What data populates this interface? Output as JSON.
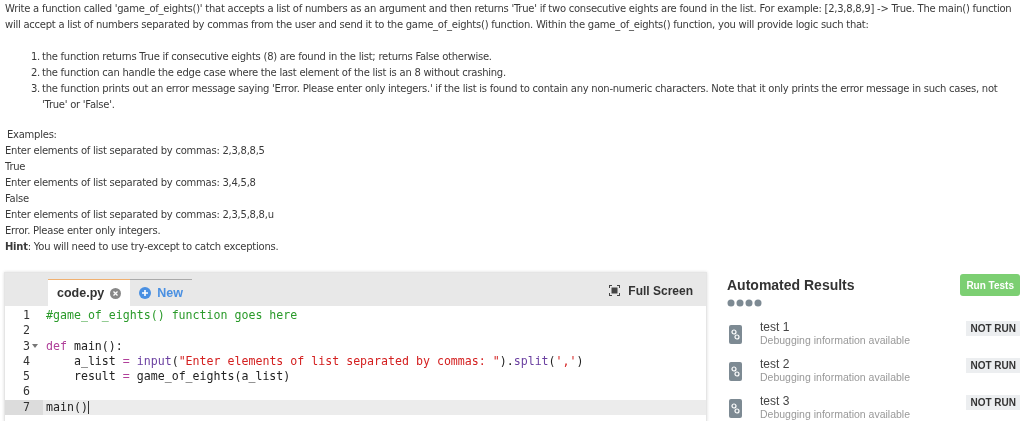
{
  "description": {
    "intro": "Write a function called 'game_of_eights()' that accepts a list of numbers as an argument and then returns 'True' if two consecutive eights are found in the list. For example: [2,3,8,8,9] -> True. The main() function will accept a list of numbers separated by commas from the user and send it to the game_of_eights() function. Within the game_of_eights() function, you will provide logic such that:",
    "requirements": [
      {
        "number": "1.",
        "text": "the function returns True if consecutive eights (8) are found in the list; returns False otherwise."
      },
      {
        "number": "2.",
        "text": "the function can handle the edge case where the last element of the list is an 8 without crashing."
      },
      {
        "number": "3.",
        "text": "the function prints out an error message saying 'Error. Please enter only integers.' if the list is found to contain any non-numeric characters. Note that it only prints the error message in such cases, not 'True' or 'False'."
      }
    ],
    "examples_heading": "Examples:",
    "example_lines": [
      "Enter elements of list separated by commas: 2,3,8,8,5",
      "True",
      "Enter elements of list separated by commas: 3,4,5,8",
      "False",
      "Enter elements of list separated by commas: 2,3,5,8,8,u",
      "Error. Please enter only integers."
    ],
    "hint": "**Hint**: You will need to use try-except to catch exceptions."
  },
  "editor": {
    "tabs": [
      {
        "label": "code.py",
        "kind": "file",
        "selected": true
      },
      {
        "label": "New",
        "kind": "new",
        "selected": false
      }
    ],
    "full_screen": "Full Screen",
    "lines": [
      {
        "number": "1",
        "foldable": false,
        "current": false,
        "tokens": [
          {
            "kind": "comment",
            "text": "#game_of_eights() function goes here"
          }
        ]
      },
      {
        "number": "2",
        "foldable": false,
        "current": false
      },
      {
        "number": "3",
        "foldable": true,
        "current": false,
        "tokens": [
          {
            "kind": "keyword",
            "text": "def"
          },
          {
            "kind": "plain",
            "text": " main():"
          }
        ]
      },
      {
        "number": "4",
        "foldable": false,
        "current": false,
        "tokens": [
          {
            "kind": "plain",
            "text": "    a_list "
          },
          {
            "kind": "operator",
            "text": "= "
          },
          {
            "kind": "builtin",
            "text": "input"
          },
          {
            "kind": "plain",
            "text": "("
          },
          {
            "kind": "string",
            "text": "\"Enter elements of list separated by commas: \""
          },
          {
            "kind": "plain",
            "text": ")."
          },
          {
            "kind": "builtin",
            "text": "split"
          },
          {
            "kind": "plain",
            "text": "("
          },
          {
            "kind": "string",
            "text": "','"
          },
          {
            "kind": "plain",
            "text": ")"
          }
        ]
      },
      {
        "number": "5",
        "foldable": false,
        "current": false,
        "tokens": [
          {
            "kind": "plain",
            "text": "    result "
          },
          {
            "kind": "operator",
            "text": "="
          },
          {
            "kind": "plain",
            "text": " game_of_eights(a_list)"
          }
        ]
      },
      {
        "number": "6",
        "foldable": false,
        "current": false
      },
      {
        "number": "7",
        "foldable": false,
        "current": true,
        "tokens": [
          {
            "kind": "plain",
            "text": "main()"
          }
        ]
      }
    ]
  },
  "results": {
    "title": "Automated Results",
    "run_button": "Run Tests",
    "tests": [
      {
        "name": "test 1",
        "info": "Debugging information available",
        "status": "NOT RUN"
      },
      {
        "name": "test 2",
        "info": "Debugging information available",
        "status": "NOT RUN"
      },
      {
        "name": "test 3",
        "info": "Debugging information available",
        "status": "NOT RUN"
      }
    ]
  }
}
